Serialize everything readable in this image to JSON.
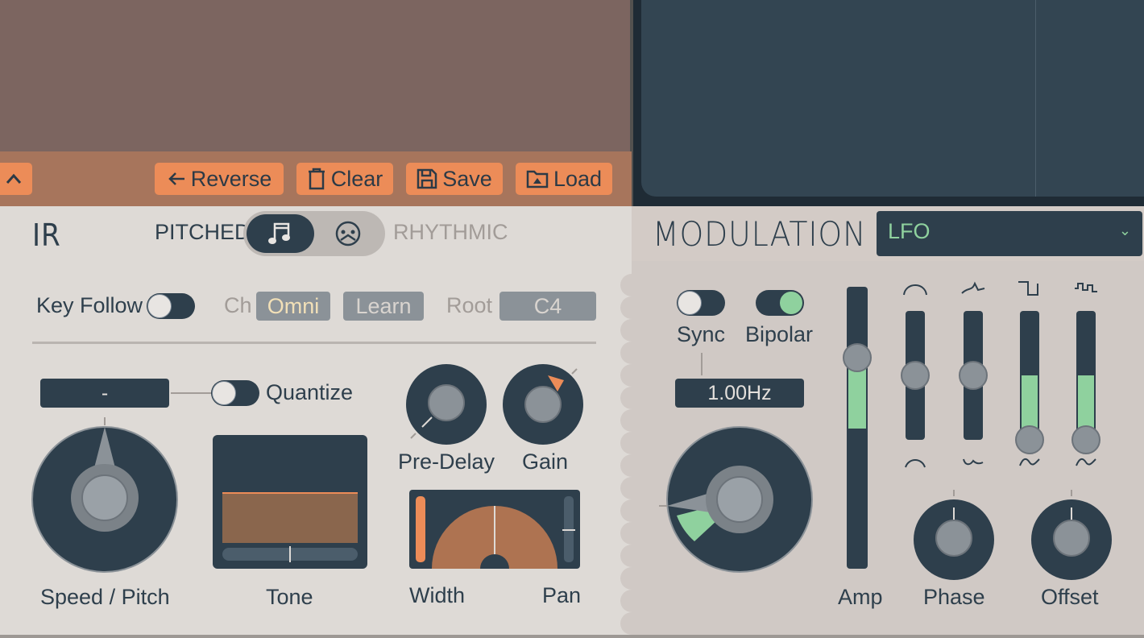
{
  "toolbar": {
    "collapse_icon": "chevron-up-icon",
    "reverse_label": "Reverse",
    "clear_label": "Clear",
    "save_label": "Save",
    "load_label": "Load"
  },
  "ir": {
    "title": "IR",
    "pitched_label": "PITCHED",
    "rhythmic_label": "RHYTHMIC",
    "mode": "pitched",
    "pitched_icon": "music-note-icon",
    "rhythmic_icon": "metronome-icon"
  },
  "modulation": {
    "title": "MODULATION",
    "source": "LFO"
  },
  "midi": {
    "key_follow_label": "Key Follow",
    "key_follow_on": false,
    "ch_label": "Ch",
    "ch_value": "Omni",
    "learn_label": "Learn",
    "root_label": "Root",
    "root_value": "C4"
  },
  "controls": {
    "speed_display": "-",
    "quantize_label": "Quantize",
    "quantize_on": false,
    "speed_pitch_label": "Speed / Pitch",
    "tone_label": "Tone",
    "pre_delay_label": "Pre-Delay",
    "gain_label": "Gain",
    "width_label": "Width",
    "pan_label": "Pan"
  },
  "lfo": {
    "sync_label": "Sync",
    "sync_on": false,
    "bipolar_label": "Bipolar",
    "bipolar_on": true,
    "rate_display": "1.00Hz",
    "amp_label": "Amp",
    "phase_label": "Phase",
    "offset_label": "Offset",
    "shape_sliders": [
      {
        "top_icon": "sine-shape-icon",
        "bottom_icon": "sine-shape-icon"
      },
      {
        "top_icon": "triangle-shape-icon",
        "bottom_icon": "saw-shape-icon"
      },
      {
        "top_icon": "square-shape-icon",
        "bottom_icon": "sine-shape-icon"
      },
      {
        "top_icon": "step-shape-icon",
        "bottom_icon": "sine-shape-icon"
      }
    ]
  },
  "colors": {
    "accent_orange": "#ec8c58",
    "accent_green": "#8fd19e",
    "dark_slate": "#2e3f4c",
    "tone_fill": "#8a664d",
    "width_fill": "#ae7351"
  }
}
